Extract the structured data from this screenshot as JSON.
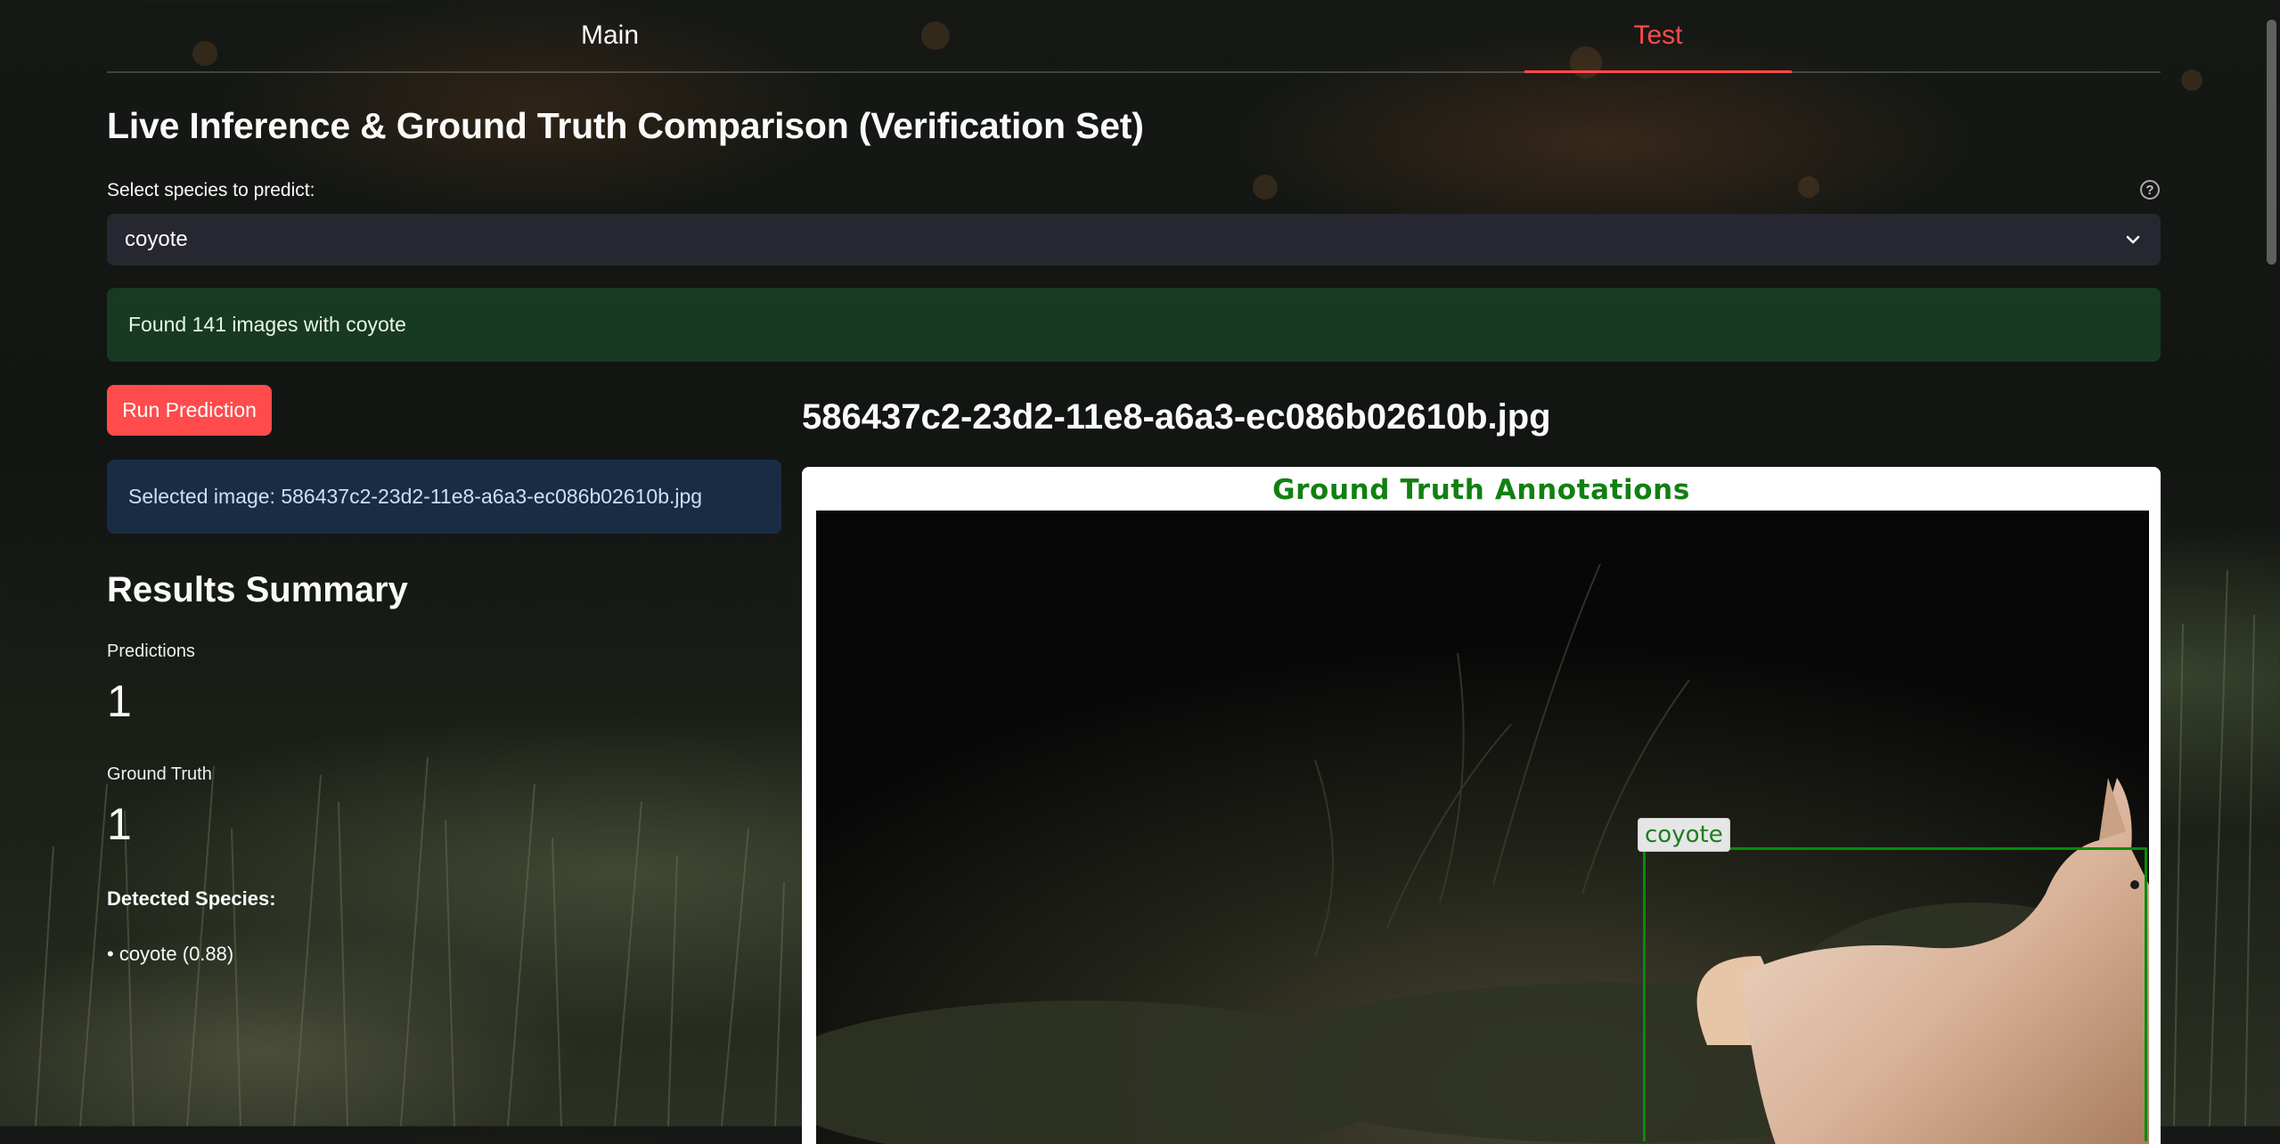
{
  "tabs": [
    {
      "label": "Main",
      "active": false
    },
    {
      "label": "Test",
      "active": true
    }
  ],
  "page_title": "Live Inference & Ground Truth Comparison (Verification Set)",
  "species_select": {
    "label": "Select species to predict:",
    "value": "coyote",
    "help_icon": "question-circle-icon",
    "chevron_icon": "chevron-down-icon"
  },
  "alert": {
    "text": "Found 141 images with coyote"
  },
  "run_button": {
    "label": "Run Prediction"
  },
  "info": {
    "text": "Selected image: 586437c2-23d2-11e8-a6a3-ec086b02610b.jpg"
  },
  "results": {
    "title": "Results Summary",
    "predictions_label": "Predictions",
    "predictions_value": "1",
    "ground_truth_label": "Ground Truth",
    "ground_truth_value": "1",
    "detected_title": "Detected Species:",
    "species": [
      "• coyote (0.88)"
    ]
  },
  "image_panel": {
    "filename": "586437c2-23d2-11e8-a6a3-ec086b02610b.jpg",
    "figure_title": "Ground Truth Annotations",
    "bbox_label": "coyote"
  },
  "colors": {
    "accent": "#ff4b4b",
    "annotation_green": "#118011",
    "alert_green": "#1f4d2c",
    "info_blue": "#1c3250",
    "select_bg": "#262730"
  }
}
